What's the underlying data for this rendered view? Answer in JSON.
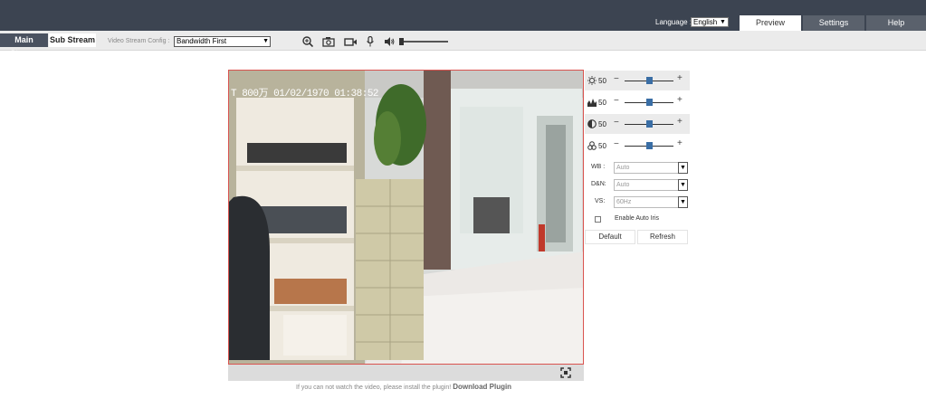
{
  "header": {
    "language_label": "Language :",
    "language_value": "English",
    "tabs": [
      {
        "label": "Preview",
        "active": true
      },
      {
        "label": "Settings",
        "active": false
      },
      {
        "label": "Help",
        "active": false
      }
    ],
    "colors": {
      "bar": "#3c4451",
      "tab_inactive": "#5a616c",
      "tab_active": "#ffffff"
    }
  },
  "toolbar": {
    "main_stream": "Main Stream",
    "sub_stream": "Sub Stream",
    "active_stream": "Main Stream",
    "video_stream_config_label": "Video Stream Config :",
    "video_stream_config_value": "Bandwidth First",
    "icons": [
      "zoom-icon",
      "snapshot-icon",
      "record-icon",
      "microphone-icon",
      "speaker-icon"
    ],
    "volume_level": 0.05
  },
  "video": {
    "osd_text": "T 800万 01/02/1970 01:38:52",
    "plugin_note": "If you can not watch the video, please install the plugin!",
    "download_plugin": "Download Plugin",
    "border_color": "#d9534f"
  },
  "image_panel": {
    "sliders": [
      {
        "name": "brightness",
        "icon": "brightness-icon",
        "value": "50",
        "level": 0.5
      },
      {
        "name": "sharpness",
        "icon": "sharpness-icon",
        "value": "50",
        "level": 0.5
      },
      {
        "name": "contrast",
        "icon": "contrast-icon",
        "value": "50",
        "level": 0.5
      },
      {
        "name": "saturation",
        "icon": "saturation-icon",
        "value": "50",
        "level": 0.5
      }
    ],
    "minus": "−",
    "plus": "+",
    "selects": [
      {
        "label": "WB :",
        "value": "Auto"
      },
      {
        "label": "D&N:",
        "value": "Auto"
      },
      {
        "label": "VS:",
        "value": "60Hz"
      }
    ],
    "auto_iris_label": "Enable Auto Iris",
    "auto_iris_checked": false,
    "default_button": "Default",
    "refresh_button": "Refresh"
  }
}
